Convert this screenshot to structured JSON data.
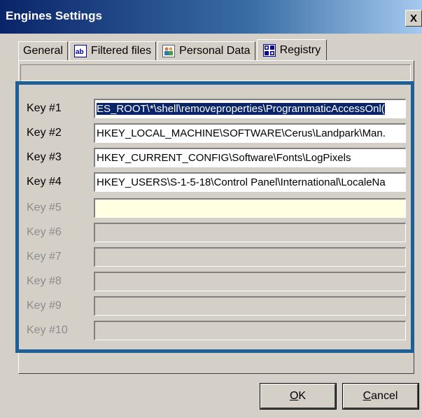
{
  "window": {
    "title": "Engines Settings",
    "close_label": "X"
  },
  "tabs": [
    {
      "label": "General",
      "icon": "none"
    },
    {
      "label": "Filtered files",
      "icon": "text-ab-icon"
    },
    {
      "label": "Personal Data",
      "icon": "people-icon"
    },
    {
      "label": "Registry",
      "icon": "registry-icon"
    }
  ],
  "active_tab": "Registry",
  "keys": [
    {
      "label": "Key #1",
      "value": "ES_ROOT\\*\\shell\\removeproperties\\ProgrammaticAccessOnl(",
      "state": "selected"
    },
    {
      "label": "Key #2",
      "value": "HKEY_LOCAL_MACHINE\\SOFTWARE\\Cerus\\Landpark\\Man.",
      "state": "normal"
    },
    {
      "label": "Key #3",
      "value": "HKEY_CURRENT_CONFIG\\Software\\Fonts\\LogPixels",
      "state": "normal"
    },
    {
      "label": "Key #4",
      "value": "HKEY_USERS\\S-1-5-18\\Control Panel\\International\\LocaleNa",
      "state": "normal"
    },
    {
      "label": "Key #5",
      "value": "",
      "state": "focused"
    },
    {
      "label": "Key #6",
      "value": "",
      "state": "disabled"
    },
    {
      "label": "Key #7",
      "value": "",
      "state": "disabled"
    },
    {
      "label": "Key #8",
      "value": "",
      "state": "disabled"
    },
    {
      "label": "Key #9",
      "value": "",
      "state": "disabled"
    },
    {
      "label": "Key #10",
      "value": "",
      "state": "disabled"
    }
  ],
  "buttons": {
    "ok": {
      "accel": "O",
      "rest": "K"
    },
    "cancel": {
      "accel": "C",
      "rest": "ancel"
    }
  },
  "colors": {
    "title_bar": "#0a246a",
    "highlight_frame": "#1d5f96",
    "focused_field": "#ffffe1"
  }
}
